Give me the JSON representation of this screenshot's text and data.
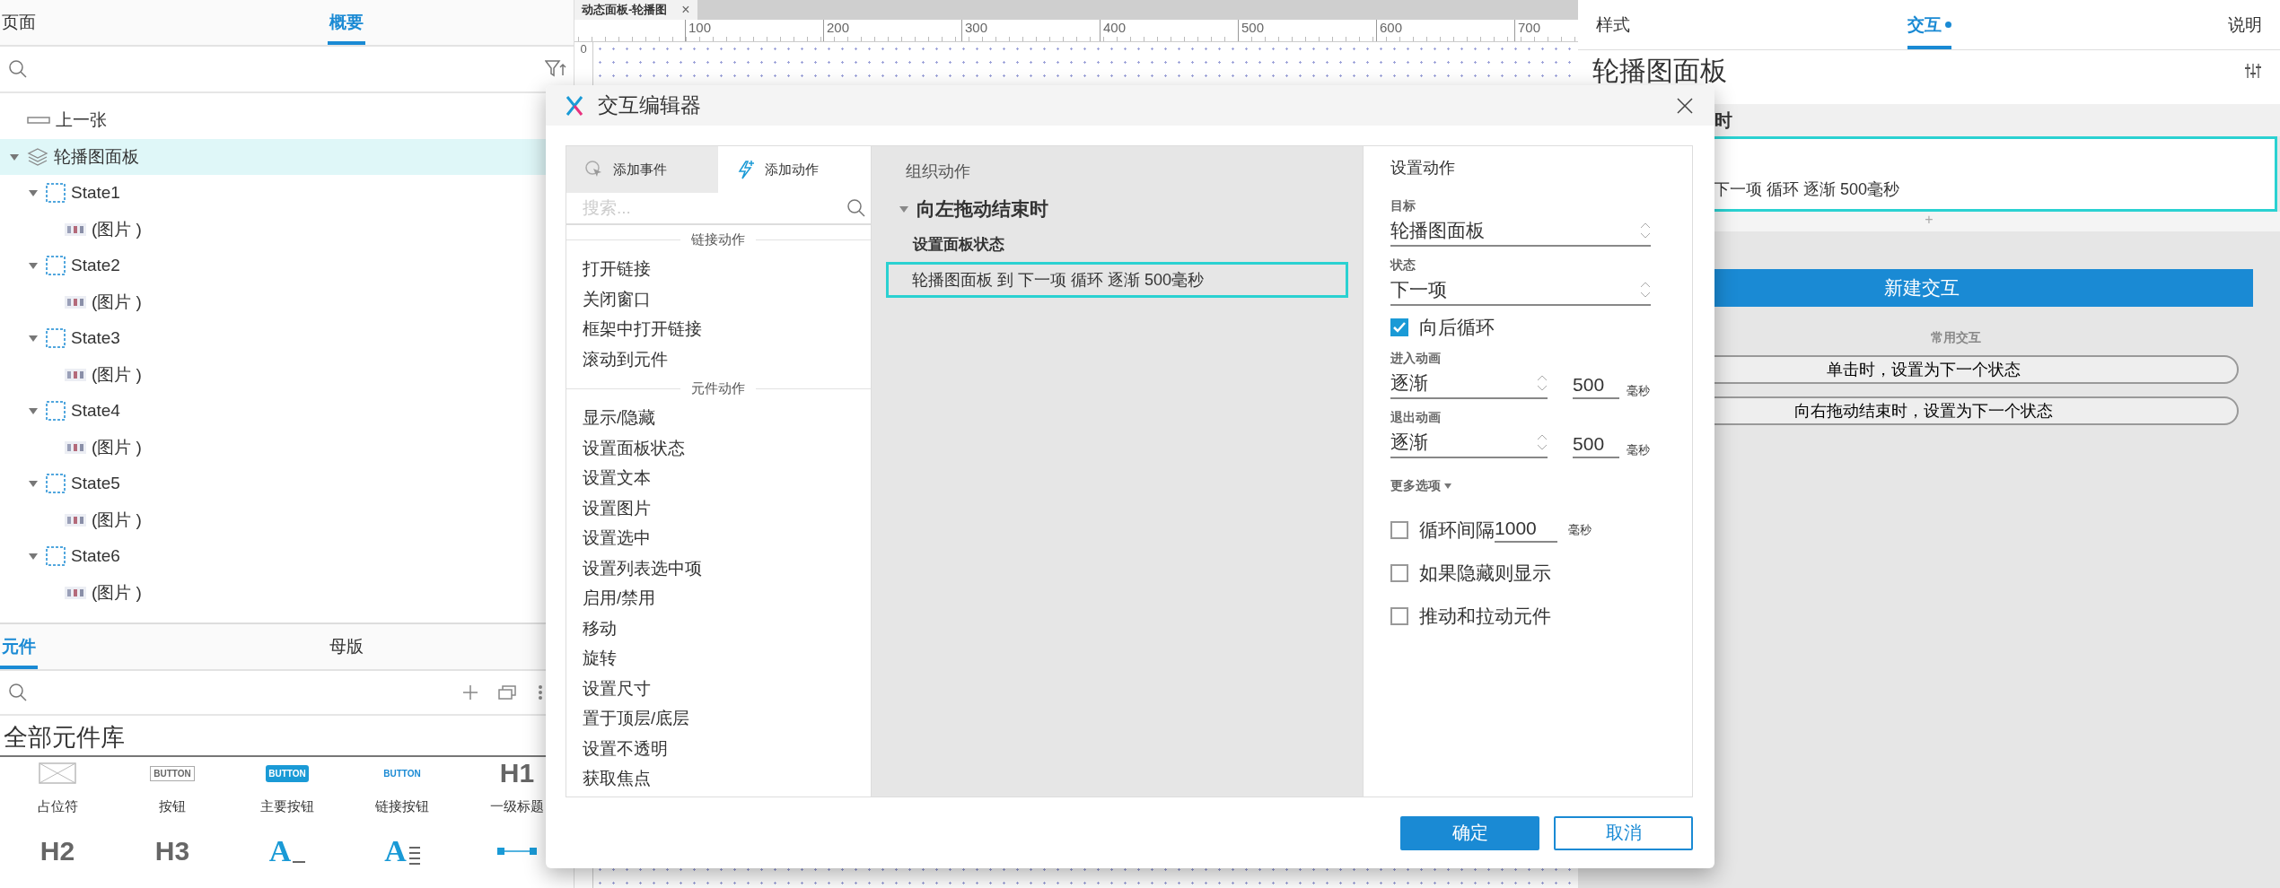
{
  "left_panel": {
    "tabs": [
      {
        "label": "页面",
        "selected": false
      },
      {
        "label": "概要",
        "selected": true
      }
    ],
    "outline": [
      {
        "label": "上一张",
        "kind": "button",
        "selected": false
      },
      {
        "label": "轮播图面板",
        "kind": "panel",
        "selected": true,
        "expanded": true,
        "children": [
          {
            "label": "State1",
            "kind": "state",
            "selected": false,
            "expanded": true,
            "children": [
              {
                "label": "(图片 )",
                "kind": "image",
                "selected": false
              }
            ]
          },
          {
            "label": "State2",
            "kind": "state",
            "selected": false,
            "expanded": true,
            "children": [
              {
                "label": "(图片 )",
                "kind": "image",
                "selected": false
              }
            ]
          },
          {
            "label": "State3",
            "kind": "state",
            "selected": false,
            "expanded": true,
            "children": [
              {
                "label": "(图片 )",
                "kind": "image",
                "selected": false
              }
            ]
          },
          {
            "label": "State4",
            "kind": "state",
            "selected": false,
            "expanded": true,
            "children": [
              {
                "label": "(图片 )",
                "kind": "image",
                "selected": false
              }
            ]
          },
          {
            "label": "State5",
            "kind": "state",
            "selected": false,
            "expanded": true,
            "children": [
              {
                "label": "(图片 )",
                "kind": "image",
                "selected": false
              }
            ]
          },
          {
            "label": "State6",
            "kind": "state",
            "selected": false,
            "expanded": true,
            "children": [
              {
                "label": "(图片 )",
                "kind": "image",
                "selected": false
              }
            ]
          }
        ]
      }
    ],
    "library_tabs": [
      {
        "label": "元件",
        "selected": true
      },
      {
        "label": "母版",
        "selected": false
      }
    ],
    "library_title": "全部元件库",
    "widgets": [
      {
        "kind": "placeholder",
        "label": "占位符"
      },
      {
        "kind": "button",
        "preview": "BUTTON",
        "label": "按钮"
      },
      {
        "kind": "primary",
        "preview": "BUTTON",
        "label": "主要按钮"
      },
      {
        "kind": "link",
        "preview": "BUTTON",
        "label": "链接按钮"
      },
      {
        "kind": "heading",
        "preview": "H1",
        "label": "一级标题"
      },
      {
        "kind": "heading",
        "preview": "H2"
      },
      {
        "kind": "heading",
        "preview": "H3"
      },
      {
        "kind": "textfield",
        "preview": "A"
      },
      {
        "kind": "textarea",
        "preview": "A"
      },
      {
        "kind": "slider"
      }
    ]
  },
  "canvas": {
    "tab": {
      "title": "动态面板-轮播图",
      "close": "×"
    },
    "ruler_zero": "0",
    "ruler": [
      "100",
      "200",
      "300",
      "400",
      "500",
      "600",
      "700"
    ]
  },
  "right_panel": {
    "tabs": [
      {
        "label": "样式",
        "selected": false,
        "dot": false
      },
      {
        "label": "交互",
        "selected": true,
        "dot": true
      },
      {
        "label": "说明",
        "selected": false,
        "dot": false
      }
    ],
    "title": "轮播图面板",
    "event_header": "时",
    "action_text": "下一项 循环 逐渐 500毫秒",
    "add": "+",
    "new_button": "新建交互",
    "common_title": "常用交互",
    "common": [
      "单击时，设置为下一个状态",
      "向右拖动结束时，设置为下一个状态"
    ]
  },
  "dialog": {
    "title": "交互编辑器",
    "tabs": [
      {
        "label": "添加事件",
        "selected": false
      },
      {
        "label": "添加动作",
        "selected": true
      }
    ],
    "search": {
      "placeholder": "搜索..."
    },
    "groups": [
      {
        "title": "链接动作",
        "items": [
          "打开链接",
          "关闭窗口",
          "框架中打开链接",
          "滚动到元件"
        ]
      },
      {
        "title": "元件动作",
        "items": [
          "显示/隐藏",
          "设置面板状态",
          "设置文本",
          "设置图片",
          "设置选中",
          "设置列表选中项",
          "启用/禁用",
          "移动",
          "旋转",
          "设置尺寸",
          "置于顶层/底层",
          "设置不透明",
          "获取焦点"
        ]
      }
    ],
    "organize_title": "组织动作",
    "event": {
      "label": "向左拖动结束时",
      "expanded": true,
      "actions": [
        {
          "title": "设置面板状态",
          "detail": "轮播图面板 到 下一项 循环 逐渐 500毫秒",
          "selected": true
        }
      ]
    },
    "settings_title": "设置动作",
    "target": {
      "label": "目标",
      "value": "轮播图面板"
    },
    "state": {
      "label": "状态",
      "value": "下一项"
    },
    "loop": {
      "label": "向后循环",
      "checked": true
    },
    "animations": [
      {
        "label": "进入动画",
        "value": "逐渐",
        "duration": "500",
        "unit": "毫秒"
      },
      {
        "label": "退出动画",
        "value": "逐渐",
        "duration": "500",
        "unit": "毫秒"
      }
    ],
    "more_options": "更多选项",
    "options": [
      {
        "kind": "interval",
        "label": "循环间隔",
        "value": "1000",
        "unit": "毫秒",
        "checked": false
      },
      {
        "kind": "plain",
        "label": "如果隐藏则显示",
        "checked": false
      },
      {
        "kind": "plain",
        "label": "推动和拉动元件",
        "checked": false
      }
    ],
    "buttons": [
      {
        "label": "确定",
        "kind": "primary"
      },
      {
        "label": "取消",
        "kind": "secondary"
      }
    ]
  }
}
